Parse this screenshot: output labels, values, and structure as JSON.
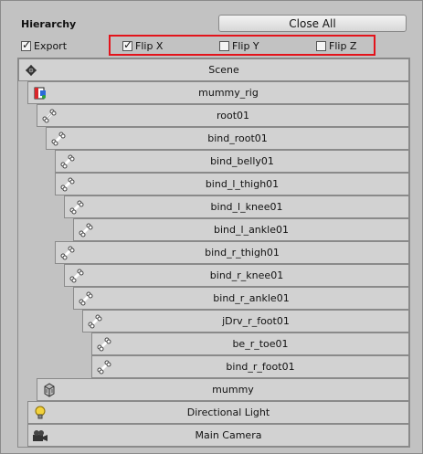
{
  "panel": {
    "title": "Hierarchy",
    "close_all_label": "Close All",
    "export": {
      "label": "Export",
      "checked": true
    },
    "flip_x": {
      "label": "Flip X",
      "checked": true
    },
    "flip_y": {
      "label": "Flip Y",
      "checked": false
    },
    "flip_z": {
      "label": "Flip Z",
      "checked": false
    },
    "highlight_color": "#e3131b"
  },
  "tree": {
    "rows": [
      {
        "label": "Scene",
        "icon": "unity-scene-icon"
      },
      {
        "label": "mummy_rig",
        "icon": "rig-icon"
      },
      {
        "label": "root01",
        "icon": "bone-icon"
      },
      {
        "label": "bind_root01",
        "icon": "bone-icon"
      },
      {
        "label": "bind_belly01",
        "icon": "bone-icon"
      },
      {
        "label": "bind_l_thigh01",
        "icon": "bone-icon"
      },
      {
        "label": "bind_l_knee01",
        "icon": "bone-icon"
      },
      {
        "label": "bind_l_ankle01",
        "icon": "bone-icon"
      },
      {
        "label": "bind_r_thigh01",
        "icon": "bone-icon"
      },
      {
        "label": "bind_r_knee01",
        "icon": "bone-icon"
      },
      {
        "label": "bind_r_ankle01",
        "icon": "bone-icon"
      },
      {
        "label": "jDrv_r_foot01",
        "icon": "bone-icon"
      },
      {
        "label": "be_r_toe01",
        "icon": "bone-icon"
      },
      {
        "label": "bind_r_foot01",
        "icon": "bone-icon"
      },
      {
        "label": "mummy",
        "icon": "mesh-icon"
      },
      {
        "label": "Directional Light",
        "icon": "light-bulb-icon"
      },
      {
        "label": "Main Camera",
        "icon": "camera-icon"
      }
    ]
  }
}
